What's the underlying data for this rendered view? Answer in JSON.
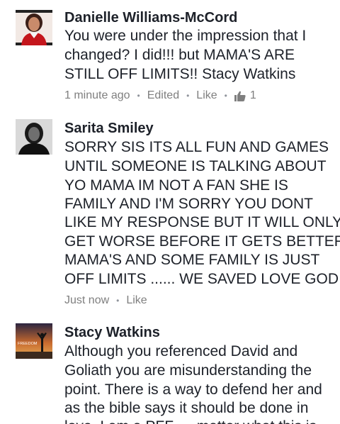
{
  "comments": [
    {
      "author": "Danielle Williams-McCord",
      "lines": [
        "You were under the impression that I",
        "changed? I did!!! but MAMA'S ARE",
        "STILL OFF LIMITS!! Stacy Watkins"
      ],
      "time": "1 minute ago",
      "edited_label": "Edited",
      "like_label": "Like",
      "like_count": "1",
      "avatar_icon": "profile-photo-woman-red"
    },
    {
      "author": "Sarita Smiley",
      "lines": [
        "SORRY SIS ITS ALL FUN AND GAMES",
        "UNTIL SOMEONE IS TALKING ABOUT",
        "YO MAMA IM NOT A FAN SHE IS",
        "FAMILY AND I'M SORRY YOU DONT",
        "LIKE MY RESPONSE BUT IT WILL ONLY",
        "GET WORSE BEFORE IT GETS BETTER",
        "MAMA'S AND SOME FAMILY IS JUST",
        "OFF LIMITS ...... WE SAVED LOVE GOD"
      ],
      "time": "Just now",
      "like_label": "Like",
      "avatar_icon": "profile-photo-woman-bw"
    },
    {
      "author": "Stacy Watkins",
      "lines": [
        "Although you referenced David and",
        "Goliath you are misunderstanding the",
        "point. There is a way to defend her and",
        "as the bible says it should be done in",
        "love. I am a PFF..... matter what this is"
      ],
      "avatar_caption": "FREEDOM",
      "avatar_icon": "profile-photo-freedom-sunset"
    }
  ],
  "colors": {
    "text": "#1d2129",
    "meta": "#90949c",
    "link": "#7f7f7f"
  }
}
